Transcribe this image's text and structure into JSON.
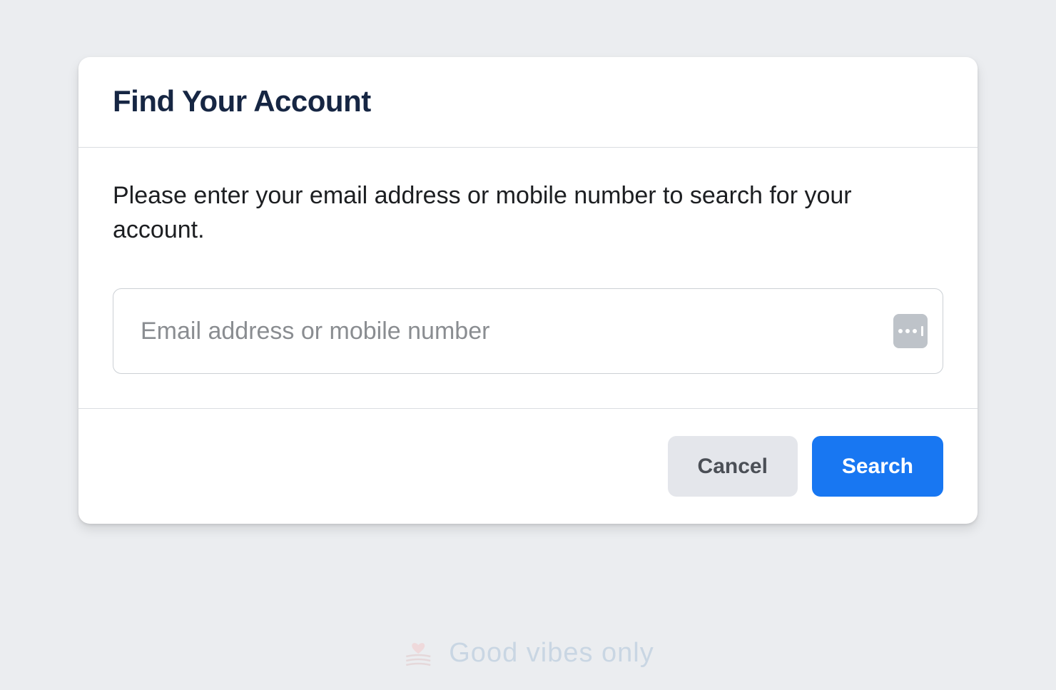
{
  "card": {
    "title": "Find Your Account",
    "instruction": "Please enter your email address or mobile number to search for your account.",
    "input": {
      "placeholder": "Email address or mobile number",
      "value": ""
    },
    "buttons": {
      "cancel": "Cancel",
      "search": "Search"
    }
  },
  "footer": {
    "brand_text": "Good vibes only"
  }
}
